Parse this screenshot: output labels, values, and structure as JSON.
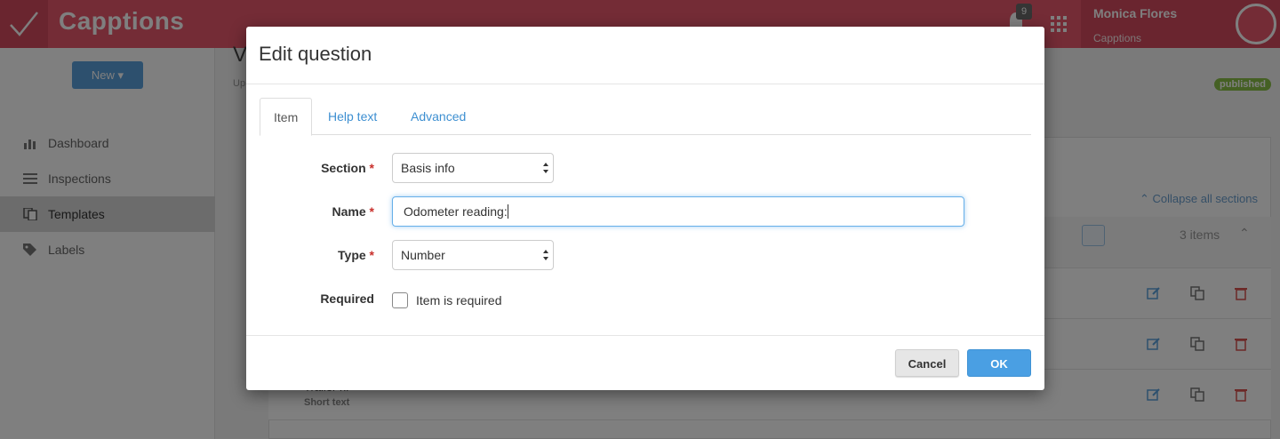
{
  "app": {
    "brand": "Capptions",
    "notification_count": "9",
    "user_name": "Monica Flores",
    "user_org": "Capptions",
    "colors": {
      "topbar": "#e8596c",
      "accent": "#4a9fe3",
      "published": "#8ac149"
    }
  },
  "sidebar": {
    "new_label": "New ▾",
    "items": [
      {
        "label": "Dashboard",
        "icon": "bar-chart-icon"
      },
      {
        "label": "Inspections",
        "icon": "list-icon"
      },
      {
        "label": "Templates",
        "icon": "copy-icon",
        "active": true
      },
      {
        "label": "Labels",
        "icon": "tags-icon"
      }
    ]
  },
  "background": {
    "title": "V",
    "subtitle": "Up",
    "published_badge": "published",
    "collapse_label": "Collapse all sections",
    "item_count": "3 items",
    "rows": [
      {
        "title": "",
        "subtitle": ""
      },
      {
        "title": "",
        "subtitle": ""
      },
      {
        "title": "Trailer nr",
        "subtitle": "Short text"
      }
    ]
  },
  "modal": {
    "title": "Edit question",
    "tabs": [
      "Item",
      "Help text",
      "Advanced"
    ],
    "active_tab": "Item",
    "section_label": "Section",
    "section_value": "Basis info",
    "name_label": "Name",
    "name_value": "Odometer reading:",
    "type_label": "Type",
    "type_value": "Number",
    "required_label": "Required",
    "required_checkbox_label": "Item is required",
    "required_checked": false,
    "required_marker": "*",
    "cancel_label": "Cancel",
    "ok_label": "OK"
  }
}
